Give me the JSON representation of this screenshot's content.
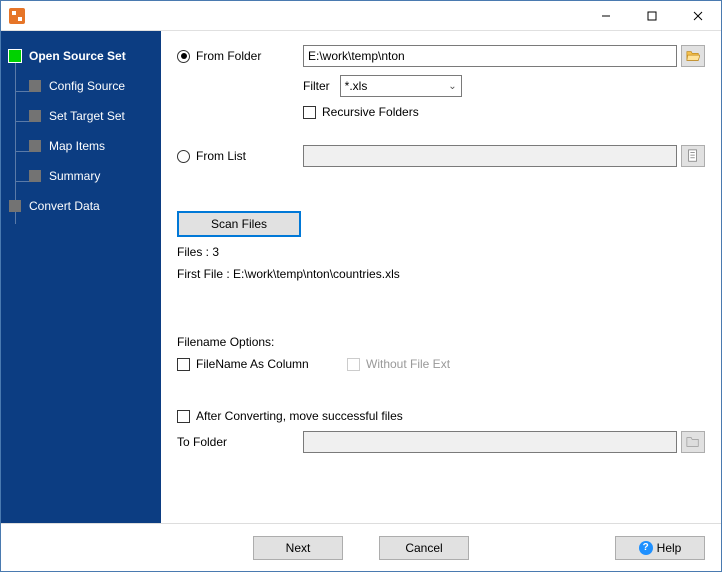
{
  "sidebar": {
    "items": [
      {
        "label": "Open Source Set",
        "active": true,
        "child": false
      },
      {
        "label": "Config Source",
        "active": false,
        "child": true
      },
      {
        "label": "Set Target Set",
        "active": false,
        "child": true
      },
      {
        "label": "Map Items",
        "active": false,
        "child": true
      },
      {
        "label": "Summary",
        "active": false,
        "child": true
      },
      {
        "label": "Convert Data",
        "active": false,
        "child": false
      }
    ]
  },
  "source": {
    "from_folder_label": "From Folder",
    "from_folder_path": "E:\\work\\temp\\nton",
    "filter_label": "Filter",
    "filter_value": "*.xls",
    "recursive_label": "Recursive Folders",
    "from_list_label": "From List",
    "from_list_path": ""
  },
  "scan": {
    "button_label": "Scan Files",
    "files_label": "Files : 3",
    "first_file_label": "First File : E:\\work\\temp\\nton\\countries.xls"
  },
  "filename_options": {
    "heading": "Filename Options:",
    "filename_as_column_label": "FileName As Column",
    "without_ext_label": "Without File Ext"
  },
  "after": {
    "move_label": "After Converting, move successful files",
    "to_folder_label": "To Folder",
    "to_folder_path": ""
  },
  "footer": {
    "next_label": "Next",
    "cancel_label": "Cancel",
    "help_label": "Help"
  }
}
